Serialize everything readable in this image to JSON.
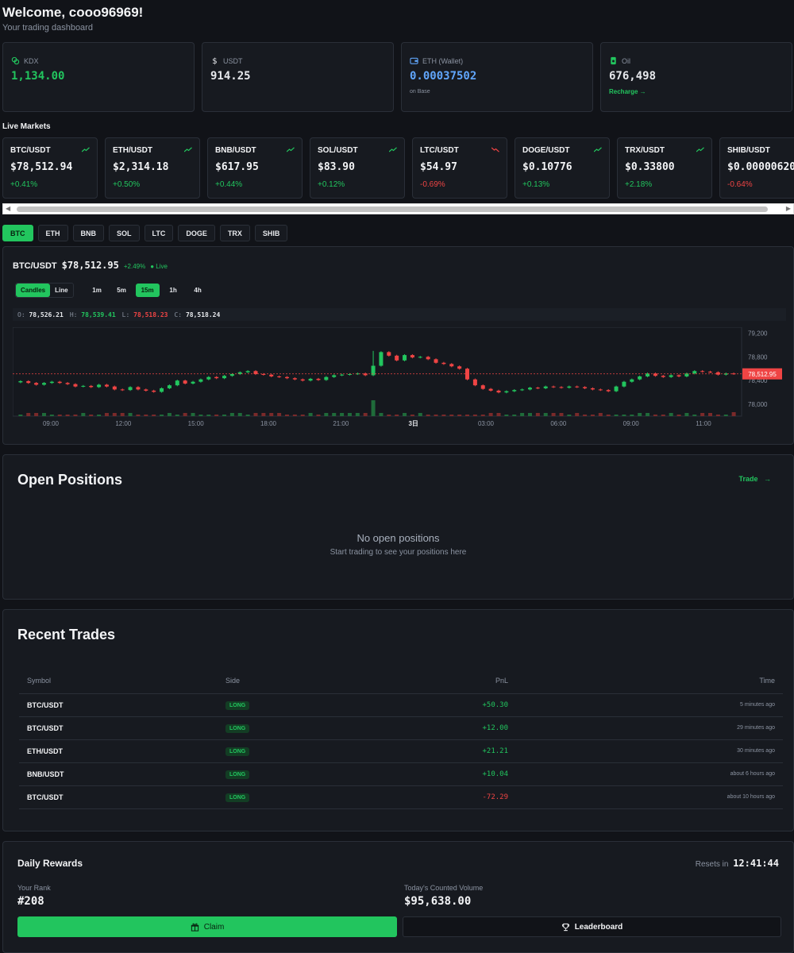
{
  "header": {
    "title": "Welcome, cooo96969!",
    "subtitle": "Your trading dashboard"
  },
  "balances": [
    {
      "label": "KDX",
      "value": "1,134.00",
      "icon": "coins-icon",
      "color": "#22c55e"
    },
    {
      "label": "USDT",
      "value": "914.25",
      "icon": "dollar-icon",
      "color": "#f3f4f6"
    },
    {
      "label": "ETH (Wallet)",
      "value": "0.00037502",
      "sub": "on Base",
      "icon": "wallet-icon",
      "color": "#60a5fa"
    },
    {
      "label": "Oil",
      "value": "676,498",
      "link": "Recharge →",
      "icon": "oil-barrel-icon",
      "color": "#f3f4f6"
    }
  ],
  "live_markets": {
    "title": "Live Markets",
    "items": [
      {
        "symbol": "BTC/USDT",
        "price": "$78,512.94",
        "change": "+0.41%",
        "up": true
      },
      {
        "symbol": "ETH/USDT",
        "price": "$2,314.18",
        "change": "+0.50%",
        "up": true
      },
      {
        "symbol": "BNB/USDT",
        "price": "$617.95",
        "change": "+0.44%",
        "up": true
      },
      {
        "symbol": "SOL/USDT",
        "price": "$83.90",
        "change": "+0.12%",
        "up": true
      },
      {
        "symbol": "LTC/USDT",
        "price": "$54.97",
        "change": "-0.69%",
        "up": false
      },
      {
        "symbol": "DOGE/USDT",
        "price": "$0.10776",
        "change": "+0.13%",
        "up": true
      },
      {
        "symbol": "TRX/USDT",
        "price": "$0.33800",
        "change": "+2.18%",
        "up": true
      },
      {
        "symbol": "SHIB/USDT",
        "price": "$0.00000620",
        "change": "-0.64%",
        "up": false
      }
    ]
  },
  "symbol_tabs": {
    "items": [
      "BTC",
      "ETH",
      "BNB",
      "SOL",
      "LTC",
      "DOGE",
      "TRX",
      "SHIB"
    ],
    "active": "BTC"
  },
  "chart": {
    "pair": "BTC/USDT",
    "price": "$78,512.95",
    "change": "+2.49%",
    "live": "● Live",
    "modes": [
      "Candles",
      "Line"
    ],
    "active_mode": "Candles",
    "intervals": [
      "1m",
      "5m",
      "15m",
      "1h",
      "4h"
    ],
    "active_interval": "15m",
    "ohlc": {
      "o_label": "O:",
      "o": "78,526.21",
      "h_label": "H:",
      "h": "78,539.41",
      "l_label": "L:",
      "l": "78,518.23",
      "c_label": "C:",
      "c": "78,518.24"
    },
    "current_price_label": "78,512.95"
  },
  "chart_data": {
    "type": "candlestick",
    "x_ticks": [
      "09:00",
      "12:00",
      "15:00",
      "18:00",
      "21:00",
      "3日",
      "03:00",
      "06:00",
      "09:00",
      "11:00"
    ],
    "y_ticks": [
      "79,200",
      "78,800",
      "78,400",
      "78,000"
    ],
    "ylim": [
      77800,
      79300
    ],
    "current_price": 78512.95,
    "close": [
      78390,
      78360,
      78330,
      78360,
      78380,
      78360,
      78340,
      78300,
      78310,
      78290,
      78330,
      78300,
      78250,
      78240,
      78290,
      78250,
      78230,
      78210,
      78270,
      78320,
      78400,
      78350,
      78380,
      78420,
      78460,
      78440,
      78480,
      78510,
      78540,
      78560,
      78510,
      78500,
      78470,
      78460,
      78440,
      78420,
      78400,
      78430,
      78410,
      78460,
      78490,
      78500,
      78510,
      78520,
      78490,
      78650,
      78880,
      78820,
      78740,
      78830,
      78790,
      78800,
      78760,
      78700,
      78680,
      78640,
      78600,
      78420,
      78320,
      78260,
      78230,
      78200,
      78220,
      78240,
      78250,
      78280,
      78270,
      78300,
      78290,
      78280,
      78300,
      78290,
      78270,
      78250,
      78240,
      78220,
      78300,
      78380,
      78420,
      78470,
      78520,
      78480,
      78460,
      78490,
      78470,
      78520,
      78560,
      78550,
      78540,
      78500,
      78520,
      78513
    ],
    "volume_spike_index": 45
  },
  "open_positions": {
    "title": "Open Positions",
    "trade_link": "Trade",
    "empty_title": "No open positions",
    "empty_subtitle": "Start trading to see your positions here"
  },
  "recent_trades": {
    "title": "Recent Trades",
    "columns": [
      "Symbol",
      "Side",
      "PnL",
      "Time"
    ],
    "rows": [
      {
        "symbol": "BTC/USDT",
        "side": "LONG",
        "pnl": "+50.30",
        "time": "5 minutes ago",
        "positive": true
      },
      {
        "symbol": "BTC/USDT",
        "side": "LONG",
        "pnl": "+12.00",
        "time": "29 minutes ago",
        "positive": true
      },
      {
        "symbol": "ETH/USDT",
        "side": "LONG",
        "pnl": "+21.21",
        "time": "30 minutes ago",
        "positive": true
      },
      {
        "symbol": "BNB/USDT",
        "side": "LONG",
        "pnl": "+10.04",
        "time": "about 6 hours ago",
        "positive": true
      },
      {
        "symbol": "BTC/USDT",
        "side": "LONG",
        "pnl": "-72.29",
        "time": "about 10 hours ago",
        "positive": false
      }
    ]
  },
  "daily_rewards": {
    "title": "Daily Rewards",
    "resets_label": "Resets in",
    "resets_time": "12:41:44",
    "rank_label": "Your Rank",
    "rank": "#208",
    "volume_label": "Today's Counted Volume",
    "volume": "$95,638.00",
    "claim_label": "Claim",
    "leaderboard_label": "Leaderboard"
  }
}
